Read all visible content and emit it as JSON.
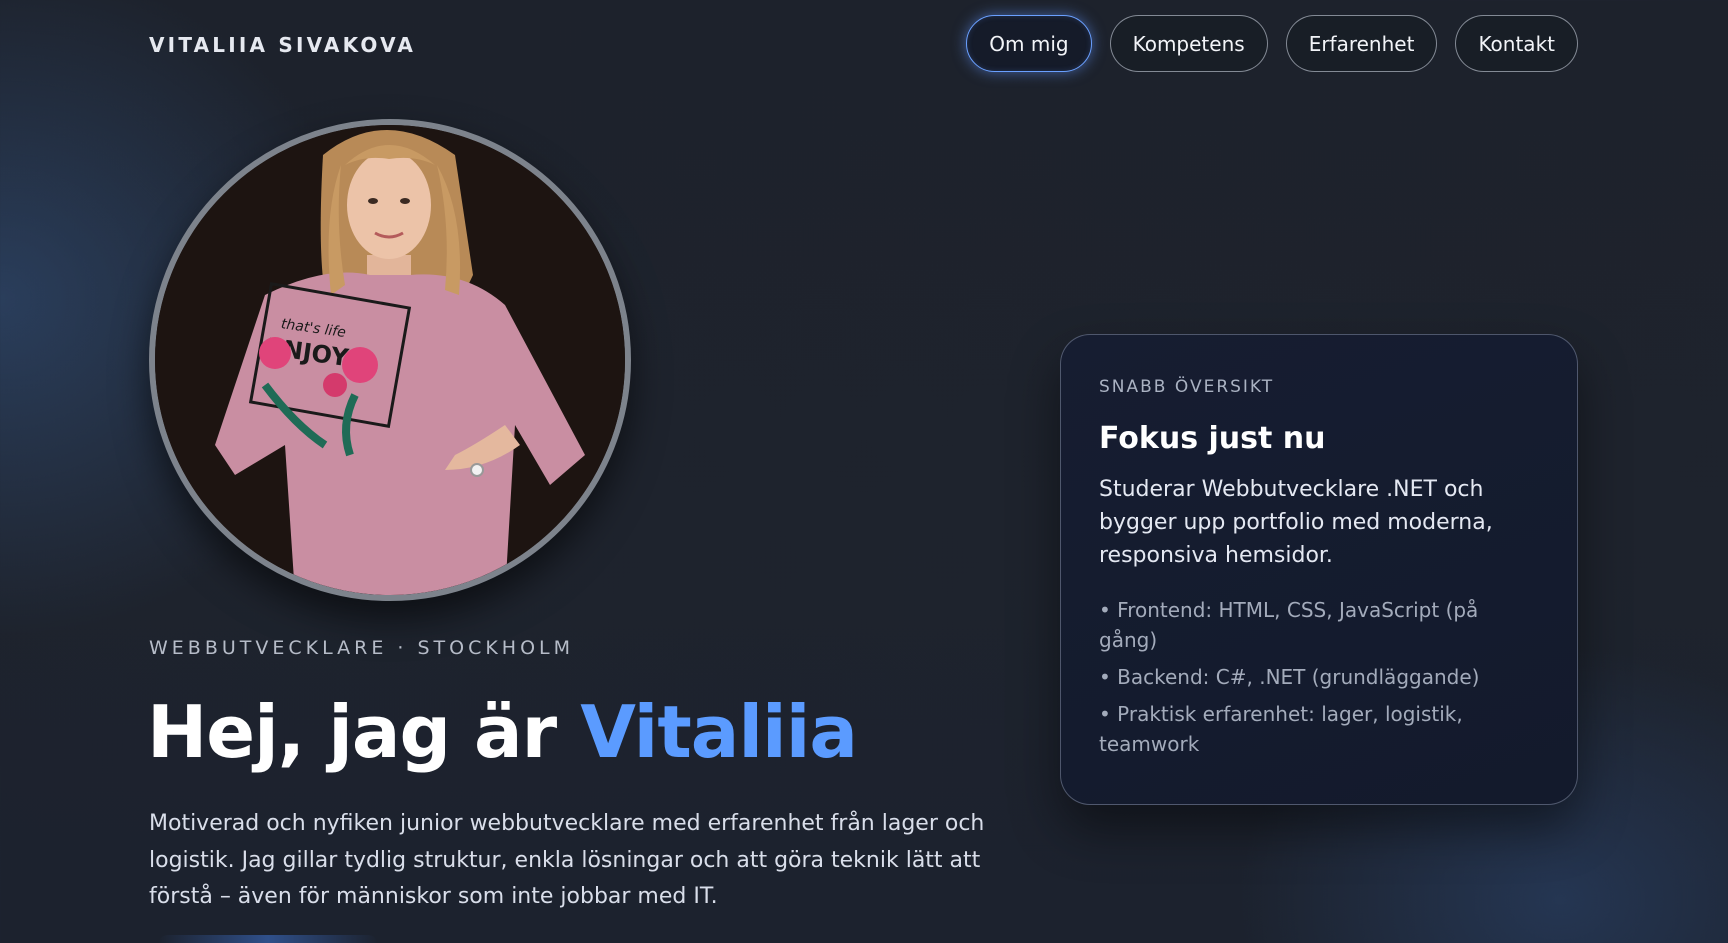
{
  "header": {
    "logo": "VITALIIA SIVAKOVA",
    "nav": [
      {
        "label": "Om mig",
        "active": true
      },
      {
        "label": "Kompetens",
        "active": false
      },
      {
        "label": "Erfarenhet",
        "active": false
      },
      {
        "label": "Kontakt",
        "active": false
      }
    ]
  },
  "hero": {
    "subtitle": "WEBBUTVECKLARE · STOCKHOLM",
    "title_prefix": "Hej, jag är ",
    "title_name": "Vitaliia",
    "intro": "Motiverad och nyfiken junior webbutvecklare med erfarenhet från lager och logistik. Jag gillar tydlig struktur, enkla lösningar och att göra teknik lätt att förstå – även för människor som inte jobbar med IT.",
    "portrait_shirt_text_1": "that's life",
    "portrait_shirt_text_2": "ENJOY"
  },
  "card": {
    "eyebrow": "SNABB ÖVERSIKT",
    "title": "Fokus just nu",
    "text": "Studerar Webbutvecklare .NET och bygger upp portfolio med moderna, responsiva hemsidor.",
    "items": [
      "• Frontend: HTML, CSS, JavaScript (på gång)",
      "• Backend: C#, .NET (grundläggande)",
      "• Praktisk erfarenhet: lager, logistik, teamwork"
    ]
  },
  "colors": {
    "accent": "#5b9bff",
    "background": "#1e232d",
    "card": "#141b2e"
  }
}
